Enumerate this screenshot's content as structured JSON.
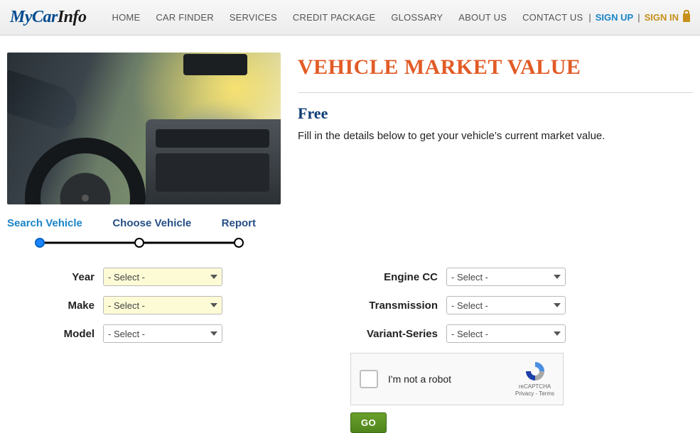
{
  "brand": {
    "part1": "MyCar",
    "part2": "Info"
  },
  "nav": {
    "home": "HOME",
    "carfinder": "CAR FINDER",
    "services": "SERVICES",
    "credit": "CREDIT PACKAGE",
    "glossary": "GLOSSARY",
    "about": "ABOUT US",
    "contact": "CONTACT US"
  },
  "auth": {
    "signup": "SIGN UP",
    "divider": "|",
    "signin": "SIGN IN"
  },
  "page": {
    "title": "VEHICLE MARKET VALUE",
    "free": "Free",
    "intro": "Fill in the details below to get your vehicle’s current market value."
  },
  "steps": {
    "s1": "Search Vehicle",
    "s2": "Choose Vehicle",
    "s3": "Report"
  },
  "form": {
    "year": {
      "label": "Year",
      "selected": "- Select -"
    },
    "make": {
      "label": "Make",
      "selected": "- Select -"
    },
    "model": {
      "label": "Model",
      "selected": "- Select -"
    },
    "engine": {
      "label": "Engine CC",
      "selected": "- Select -"
    },
    "trans": {
      "label": "Transmission",
      "selected": "- Select -"
    },
    "variant": {
      "label": "Variant-Series",
      "selected": "- Select -"
    }
  },
  "captcha": {
    "label": "I'm not a robot",
    "brand": "reCAPTCHA",
    "legal": "Privacy - Terms"
  },
  "go": "GO"
}
